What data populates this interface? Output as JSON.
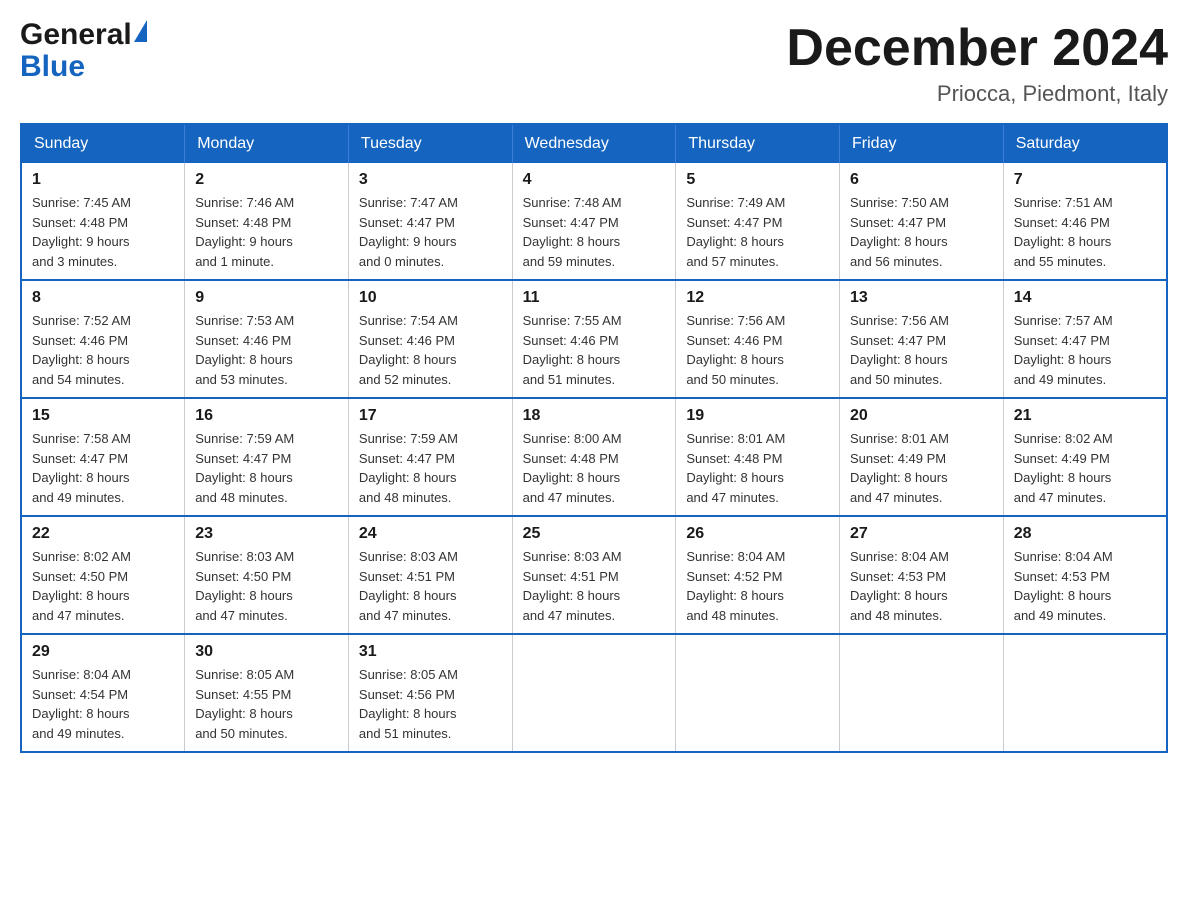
{
  "header": {
    "logo_general": "General",
    "logo_blue": "Blue",
    "month_title": "December 2024",
    "location": "Priocca, Piedmont, Italy"
  },
  "days_of_week": [
    "Sunday",
    "Monday",
    "Tuesday",
    "Wednesday",
    "Thursday",
    "Friday",
    "Saturday"
  ],
  "weeks": [
    [
      {
        "day": "1",
        "sunrise": "7:45 AM",
        "sunset": "4:48 PM",
        "daylight": "9 hours and 3 minutes."
      },
      {
        "day": "2",
        "sunrise": "7:46 AM",
        "sunset": "4:48 PM",
        "daylight": "9 hours and 1 minute."
      },
      {
        "day": "3",
        "sunrise": "7:47 AM",
        "sunset": "4:47 PM",
        "daylight": "9 hours and 0 minutes."
      },
      {
        "day": "4",
        "sunrise": "7:48 AM",
        "sunset": "4:47 PM",
        "daylight": "8 hours and 59 minutes."
      },
      {
        "day": "5",
        "sunrise": "7:49 AM",
        "sunset": "4:47 PM",
        "daylight": "8 hours and 57 minutes."
      },
      {
        "day": "6",
        "sunrise": "7:50 AM",
        "sunset": "4:47 PM",
        "daylight": "8 hours and 56 minutes."
      },
      {
        "day": "7",
        "sunrise": "7:51 AM",
        "sunset": "4:46 PM",
        "daylight": "8 hours and 55 minutes."
      }
    ],
    [
      {
        "day": "8",
        "sunrise": "7:52 AM",
        "sunset": "4:46 PM",
        "daylight": "8 hours and 54 minutes."
      },
      {
        "day": "9",
        "sunrise": "7:53 AM",
        "sunset": "4:46 PM",
        "daylight": "8 hours and 53 minutes."
      },
      {
        "day": "10",
        "sunrise": "7:54 AM",
        "sunset": "4:46 PM",
        "daylight": "8 hours and 52 minutes."
      },
      {
        "day": "11",
        "sunrise": "7:55 AM",
        "sunset": "4:46 PM",
        "daylight": "8 hours and 51 minutes."
      },
      {
        "day": "12",
        "sunrise": "7:56 AM",
        "sunset": "4:46 PM",
        "daylight": "8 hours and 50 minutes."
      },
      {
        "day": "13",
        "sunrise": "7:56 AM",
        "sunset": "4:47 PM",
        "daylight": "8 hours and 50 minutes."
      },
      {
        "day": "14",
        "sunrise": "7:57 AM",
        "sunset": "4:47 PM",
        "daylight": "8 hours and 49 minutes."
      }
    ],
    [
      {
        "day": "15",
        "sunrise": "7:58 AM",
        "sunset": "4:47 PM",
        "daylight": "8 hours and 49 minutes."
      },
      {
        "day": "16",
        "sunrise": "7:59 AM",
        "sunset": "4:47 PM",
        "daylight": "8 hours and 48 minutes."
      },
      {
        "day": "17",
        "sunrise": "7:59 AM",
        "sunset": "4:47 PM",
        "daylight": "8 hours and 48 minutes."
      },
      {
        "day": "18",
        "sunrise": "8:00 AM",
        "sunset": "4:48 PM",
        "daylight": "8 hours and 47 minutes."
      },
      {
        "day": "19",
        "sunrise": "8:01 AM",
        "sunset": "4:48 PM",
        "daylight": "8 hours and 47 minutes."
      },
      {
        "day": "20",
        "sunrise": "8:01 AM",
        "sunset": "4:49 PM",
        "daylight": "8 hours and 47 minutes."
      },
      {
        "day": "21",
        "sunrise": "8:02 AM",
        "sunset": "4:49 PM",
        "daylight": "8 hours and 47 minutes."
      }
    ],
    [
      {
        "day": "22",
        "sunrise": "8:02 AM",
        "sunset": "4:50 PM",
        "daylight": "8 hours and 47 minutes."
      },
      {
        "day": "23",
        "sunrise": "8:03 AM",
        "sunset": "4:50 PM",
        "daylight": "8 hours and 47 minutes."
      },
      {
        "day": "24",
        "sunrise": "8:03 AM",
        "sunset": "4:51 PM",
        "daylight": "8 hours and 47 minutes."
      },
      {
        "day": "25",
        "sunrise": "8:03 AM",
        "sunset": "4:51 PM",
        "daylight": "8 hours and 47 minutes."
      },
      {
        "day": "26",
        "sunrise": "8:04 AM",
        "sunset": "4:52 PM",
        "daylight": "8 hours and 48 minutes."
      },
      {
        "day": "27",
        "sunrise": "8:04 AM",
        "sunset": "4:53 PM",
        "daylight": "8 hours and 48 minutes."
      },
      {
        "day": "28",
        "sunrise": "8:04 AM",
        "sunset": "4:53 PM",
        "daylight": "8 hours and 49 minutes."
      }
    ],
    [
      {
        "day": "29",
        "sunrise": "8:04 AM",
        "sunset": "4:54 PM",
        "daylight": "8 hours and 49 minutes."
      },
      {
        "day": "30",
        "sunrise": "8:05 AM",
        "sunset": "4:55 PM",
        "daylight": "8 hours and 50 minutes."
      },
      {
        "day": "31",
        "sunrise": "8:05 AM",
        "sunset": "4:56 PM",
        "daylight": "8 hours and 51 minutes."
      },
      null,
      null,
      null,
      null
    ]
  ],
  "labels": {
    "sunrise": "Sunrise:",
    "sunset": "Sunset:",
    "daylight": "Daylight:"
  }
}
